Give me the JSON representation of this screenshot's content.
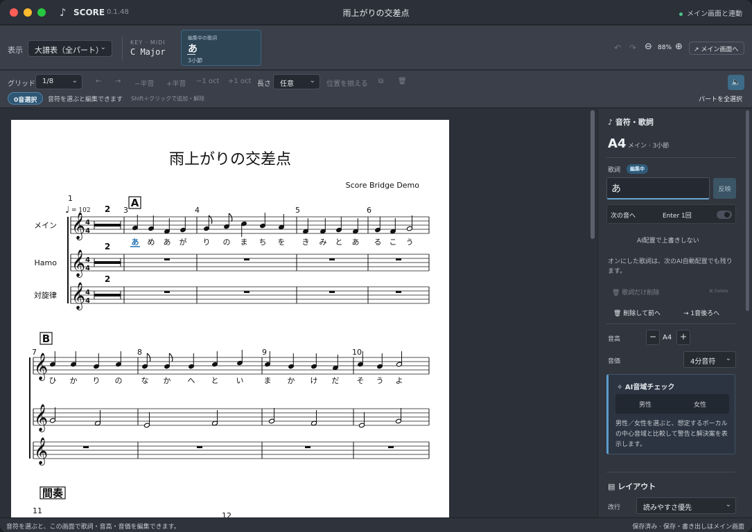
{
  "window": {
    "app_name": "SCORE",
    "app_version": "0.1.48",
    "title": "雨上がりの交差点",
    "sync_status": "メイン画面と連動"
  },
  "header": {
    "view_label": "表示",
    "view_value": "大譜表（全パート）",
    "key_label": "KEY · MIDI",
    "key_value": "C Major",
    "editing_label": "編集中の歌詞",
    "editing_value": "あ",
    "editing_bar": "3小節",
    "zoom": "88%",
    "to_main": "↗ メイン画面へ"
  },
  "toolbar": {
    "grid_label": "グリッド",
    "grid_value": "1/8",
    "left": "←",
    "right": "→",
    "semitone_down": "−半音",
    "semitone_up": "+半音",
    "oct_down": "−1 oct",
    "oct_up": "+1 oct",
    "length_label": "長さ",
    "length_value": "任意",
    "align": "位置を揃える",
    "selection_count": "0音選択",
    "selection_hint": "音符を選ぶと編集できます",
    "selection_hint2": "Shift＋クリックで追加・解除",
    "select_all": "パートを全選択"
  },
  "score": {
    "title": "雨上がりの交差点",
    "composer": "Score Bridge Demo",
    "tempo": "= 102",
    "parts": [
      "メイン",
      "Hamo",
      "対旋律"
    ],
    "section_marks": [
      "A",
      "B",
      "間奏"
    ],
    "measure_numbers": [
      "1",
      "3",
      "4",
      "5",
      "6",
      "7",
      "8",
      "9",
      "10",
      "11",
      "12"
    ],
    "rest_count": "2",
    "lyrics_row1": [
      "あ",
      "め",
      "あ",
      "が",
      "り",
      "の",
      "ま",
      "ち",
      "を",
      "き",
      "み",
      "と",
      "あ",
      "る",
      "こ",
      "う"
    ],
    "lyrics_row2": [
      "ひ",
      "か",
      "り",
      "の",
      "な",
      "か",
      "へ",
      "と",
      "い",
      "ま",
      "か",
      "け",
      "だ",
      "そ",
      "う",
      "よ"
    ]
  },
  "panel": {
    "section_title": "音符・歌詞",
    "pitch": "A4",
    "location": "メイン · 3小節",
    "lyric_label": "歌詞",
    "editing_badge": "編集中",
    "lyric_value": "あ",
    "apply": "反映",
    "next_note": "次の音へ",
    "enter_once": "Enter 1回",
    "ai_no_overwrite": "AI配置で上書きしない",
    "note_text": "オンにした歌詞は、次のAI自動配置でも残ります。",
    "delete_lyric": "歌詞だけ削除",
    "delete_key": "⌘ Delete",
    "delete_prev": "削除して前へ",
    "back_one": "→ 1音後ろへ",
    "pitch_label": "音高",
    "pitch_value": "A4",
    "duration_label": "音価",
    "duration_value": "4分音符",
    "ai_range_title": "AI音域チェック",
    "male": "男性",
    "female": "女性",
    "ai_range_desc": "男性／女性を選ぶと、想定するボーカルの中心音域と比較して警告と解決案を表示します。",
    "layout_title": "レイアウト",
    "line_break_label": "改行",
    "line_break_value": "読みやすさ優先"
  },
  "status": {
    "left": "音符を選ぶと、この画面で歌詞・音高・音価を編集できます。",
    "right": "保存済み · 保存・書き出しはメイン画面"
  },
  "colors": {
    "accent": "#4f86ad",
    "highlight_lyric": "#1f6fb2",
    "panel_bg": "#31353e",
    "page_bg": "#ffffff"
  }
}
